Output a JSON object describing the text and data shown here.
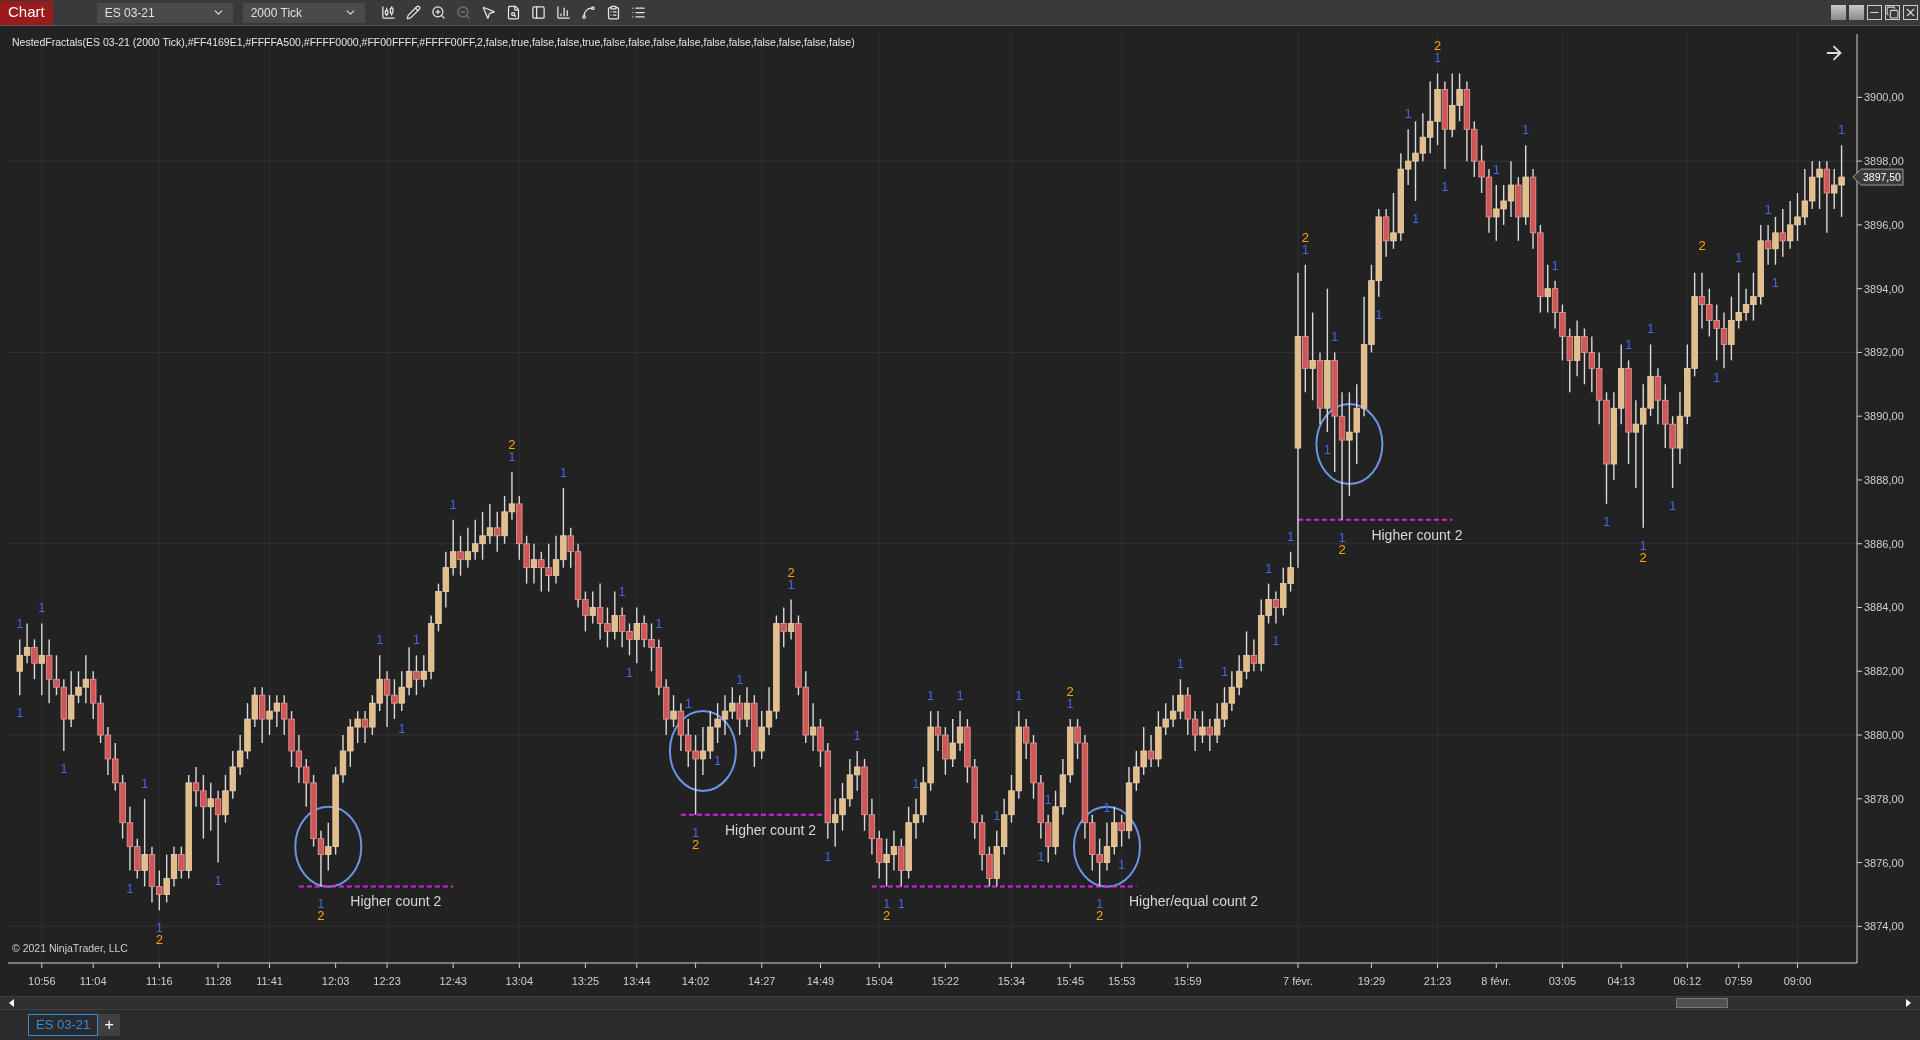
{
  "toolbar": {
    "title": "Chart",
    "instrument": "ES 03-21",
    "interval": "2000 Tick"
  },
  "indicator_label": "NestedFractals(ES 03-21 (2000 Tick),#FF4169E1,#FFFFA500,#FFFF0000,#FF00FFFF,#FFFF00FF,2,false,true,false,false,true,false,false,false,false,false,false,false,false,false,false)",
  "chart": {
    "copyright": "© 2021 NinjaTrader, LLC",
    "price_marker": "3897,50",
    "chart_data": {
      "type": "candlestick",
      "grid": true,
      "ylim": [
        3872.85,
        3902.05
      ],
      "categories": [
        null,
        null,
        null,
        "10:56",
        null,
        null,
        null,
        null,
        null,
        null,
        "11:04",
        null,
        null,
        null,
        null,
        null,
        null,
        null,
        null,
        "11:16",
        null,
        null,
        null,
        null,
        null,
        null,
        null,
        "11:28",
        null,
        null,
        null,
        null,
        null,
        null,
        "11:41",
        null,
        null,
        null,
        null,
        null,
        null,
        null,
        null,
        "12:03",
        null,
        null,
        null,
        null,
        null,
        null,
        "12:23",
        null,
        null,
        null,
        null,
        null,
        null,
        null,
        null,
        "12:43",
        null,
        null,
        null,
        null,
        null,
        null,
        null,
        null,
        "13:04",
        null,
        null,
        null,
        null,
        null,
        null,
        null,
        null,
        "13:25",
        null,
        null,
        null,
        null,
        null,
        null,
        "13:44",
        null,
        null,
        null,
        null,
        null,
        null,
        null,
        "14:02",
        null,
        null,
        null,
        null,
        null,
        null,
        null,
        null,
        "14:27",
        null,
        null,
        null,
        null,
        null,
        null,
        null,
        "14:49",
        null,
        null,
        null,
        null,
        null,
        null,
        null,
        "15:04",
        null,
        null,
        null,
        null,
        null,
        null,
        null,
        null,
        "15:22",
        null,
        null,
        null,
        null,
        null,
        null,
        null,
        null,
        "15:34",
        null,
        null,
        null,
        null,
        null,
        null,
        null,
        "15:45",
        null,
        null,
        null,
        null,
        null,
        null,
        "15:53",
        null,
        null,
        null,
        null,
        null,
        null,
        null,
        null,
        "15:59",
        null,
        null,
        null,
        null,
        null,
        null,
        null,
        null,
        null,
        null,
        null,
        null,
        null,
        null,
        "7 févr.",
        null,
        null,
        null,
        null,
        null,
        null,
        null,
        null,
        null,
        "19:29",
        null,
        null,
        null,
        null,
        null,
        null,
        null,
        null,
        "21:23",
        null,
        null,
        null,
        null,
        null,
        null,
        null,
        "8 févr.",
        null,
        null,
        null,
        null,
        null,
        null,
        null,
        null,
        "03:05",
        null,
        null,
        null,
        null,
        null,
        null,
        null,
        "04:13",
        null,
        null,
        null,
        null,
        null,
        null,
        null,
        null,
        "06:12",
        null,
        null,
        null,
        null,
        null,
        null,
        "07:59",
        null,
        null,
        null,
        null,
        null,
        null,
        null,
        "09:00",
        null,
        null,
        null,
        null,
        null,
        null
      ],
      "yticks": [
        {
          "value": 3874,
          "label": "3874,00"
        },
        {
          "value": 3876,
          "label": "3876,00"
        },
        {
          "value": 3878,
          "label": "3878,00"
        },
        {
          "value": 3880,
          "label": "3880,00"
        },
        {
          "value": 3882,
          "label": "3882,00"
        },
        {
          "value": 3884,
          "label": "3884,00"
        },
        {
          "value": 3886,
          "label": "3886,00"
        },
        {
          "value": 3888,
          "label": "3888,00"
        },
        {
          "value": 3890,
          "label": "3890,00"
        },
        {
          "value": 3892,
          "label": "3892,00"
        },
        {
          "value": 3894,
          "label": "3894,00"
        },
        {
          "value": 3896,
          "label": "3896,00"
        },
        {
          "value": 3898,
          "label": "3898,00"
        },
        {
          "value": 3900,
          "label": "3900,00"
        }
      ],
      "ohlc": [
        [
          3882,
          3883,
          3881.25,
          3882.5
        ],
        [
          3882.5,
          3883.5,
          3882.25,
          3882.75
        ],
        [
          3882.75,
          3883,
          3881.75,
          3882.25
        ],
        [
          3882.25,
          3883.5,
          3881.25,
          3882.5
        ],
        [
          3882.5,
          3883,
          3881,
          3881.75
        ],
        [
          3881.75,
          3882.5,
          3881.25,
          3881.5
        ],
        [
          3881.5,
          3881.75,
          3879.5,
          3880.5
        ],
        [
          3880.5,
          3882,
          3880.25,
          3881.25
        ],
        [
          3881.25,
          3882,
          3881,
          3881.5
        ],
        [
          3881.5,
          3882.5,
          3881,
          3881.75
        ],
        [
          3881.75,
          3882,
          3880.5,
          3881
        ],
        [
          3881,
          3881.25,
          3879.75,
          3880
        ],
        [
          3880,
          3880.25,
          3878.75,
          3879.25
        ],
        [
          3879.25,
          3879.75,
          3878.25,
          3878.5
        ],
        [
          3878.5,
          3878.75,
          3876.75,
          3877.25
        ],
        [
          3877.25,
          3877.75,
          3875.75,
          3876.5
        ],
        [
          3876.5,
          3876.75,
          3875.5,
          3875.75
        ],
        [
          3875.75,
          3878,
          3875.25,
          3876.25
        ],
        [
          3876.25,
          3876.5,
          3874.75,
          3875.25
        ],
        [
          3875.25,
          3875.75,
          3874.5,
          3875
        ],
        [
          3875,
          3876.25,
          3874.75,
          3875.5
        ],
        [
          3875.5,
          3876.5,
          3875.25,
          3876.25
        ],
        [
          3876.25,
          3876.5,
          3875.5,
          3875.75
        ],
        [
          3875.75,
          3878.75,
          3875.5,
          3878.5
        ],
        [
          3878.5,
          3879,
          3877.75,
          3878.25
        ],
        [
          3878.25,
          3878.75,
          3876.75,
          3877.75
        ],
        [
          3877.75,
          3878.5,
          3877,
          3878
        ],
        [
          3878,
          3878.25,
          3876,
          3877.5
        ],
        [
          3877.5,
          3878.75,
          3877.25,
          3878.25
        ],
        [
          3878.25,
          3879.5,
          3878,
          3879
        ],
        [
          3879,
          3880,
          3878.75,
          3879.5
        ],
        [
          3879.5,
          3881,
          3879.25,
          3880.5
        ],
        [
          3880.5,
          3881.5,
          3880.25,
          3881.25
        ],
        [
          3881.25,
          3881.5,
          3879.75,
          3880.5
        ],
        [
          3880.5,
          3881.25,
          3880,
          3880.75
        ],
        [
          3880.75,
          3881.25,
          3880.25,
          3881
        ],
        [
          3881,
          3881.25,
          3880,
          3880.5
        ],
        [
          3880.5,
          3880.75,
          3879,
          3879.5
        ],
        [
          3879.5,
          3880,
          3878.5,
          3879
        ],
        [
          3879,
          3879.25,
          3877.75,
          3878.5
        ],
        [
          3878.5,
          3878.75,
          3876.5,
          3876.75
        ],
        [
          3876.75,
          3877,
          3875.25,
          3876.25
        ],
        [
          3876.25,
          3877.25,
          3875.75,
          3876.5
        ],
        [
          3876.5,
          3879,
          3876.25,
          3878.75
        ],
        [
          3878.75,
          3880,
          3878.5,
          3879.5
        ],
        [
          3879.5,
          3880.5,
          3879,
          3880.25
        ],
        [
          3880.25,
          3880.75,
          3879.75,
          3880.5
        ],
        [
          3880.5,
          3880.75,
          3879.75,
          3880.25
        ],
        [
          3880.25,
          3881.25,
          3880,
          3881
        ],
        [
          3881,
          3882.5,
          3880.75,
          3881.75
        ],
        [
          3881.75,
          3882,
          3880.25,
          3881.25
        ],
        [
          3881.25,
          3881.75,
          3880.5,
          3881
        ],
        [
          3881,
          3882,
          3880.75,
          3881.5
        ],
        [
          3881.5,
          3882.75,
          3881.25,
          3882
        ],
        [
          3882,
          3882.5,
          3881.25,
          3881.75
        ],
        [
          3881.75,
          3882.5,
          3881.5,
          3882
        ],
        [
          3882,
          3883.75,
          3881.75,
          3883.5
        ],
        [
          3883.5,
          3884.75,
          3883.25,
          3884.5
        ],
        [
          3884.5,
          3885.75,
          3884,
          3885.25
        ],
        [
          3885.25,
          3886.75,
          3885,
          3885.75
        ],
        [
          3885.75,
          3886.25,
          3885,
          3885.5
        ],
        [
          3885.5,
          3886.5,
          3885.25,
          3885.75
        ],
        [
          3885.75,
          3886.75,
          3885.5,
          3886
        ],
        [
          3886,
          3887,
          3885.5,
          3886.25
        ],
        [
          3886.25,
          3887.25,
          3886,
          3886.5
        ],
        [
          3886.5,
          3887,
          3885.75,
          3886.25
        ],
        [
          3886.25,
          3887.5,
          3886,
          3887
        ],
        [
          3887,
          3888.25,
          3886.75,
          3887.25
        ],
        [
          3887.25,
          3887.5,
          3885.5,
          3886
        ],
        [
          3886,
          3886.25,
          3884.75,
          3885.25
        ],
        [
          3885.25,
          3886,
          3884.75,
          3885.5
        ],
        [
          3885.5,
          3885.75,
          3884.5,
          3885.25
        ],
        [
          3885.25,
          3886,
          3884.5,
          3885
        ],
        [
          3885,
          3886.25,
          3884.75,
          3885.5
        ],
        [
          3885.5,
          3887.75,
          3885.25,
          3886.25
        ],
        [
          3886.25,
          3886.5,
          3885.25,
          3885.75
        ],
        [
          3885.75,
          3886,
          3884,
          3884.25
        ],
        [
          3884.25,
          3884.5,
          3883.25,
          3883.75
        ],
        [
          3883.75,
          3884.5,
          3883.5,
          3884
        ],
        [
          3884,
          3884.75,
          3883,
          3883.5
        ],
        [
          3883.5,
          3884,
          3882.75,
          3883.25
        ],
        [
          3883.25,
          3884.5,
          3883,
          3883.75
        ],
        [
          3883.75,
          3884,
          3882.75,
          3883.25
        ],
        [
          3883.25,
          3883.5,
          3882.5,
          3883
        ],
        [
          3883,
          3884,
          3882.25,
          3883.5
        ],
        [
          3883.5,
          3883.75,
          3882.75,
          3883
        ],
        [
          3883,
          3883.5,
          3882,
          3882.75
        ],
        [
          3882.75,
          3883,
          3881.25,
          3881.5
        ],
        [
          3881.5,
          3881.75,
          3880,
          3880.5
        ],
        [
          3880.5,
          3881.25,
          3880.25,
          3880.75
        ],
        [
          3880.75,
          3881,
          3879.5,
          3880
        ],
        [
          3880,
          3880.5,
          3879,
          3879.5
        ],
        [
          3879.5,
          3880,
          3877.5,
          3879.25
        ],
        [
          3879.25,
          3880.25,
          3878.75,
          3879.5
        ],
        [
          3879.5,
          3880.75,
          3879.25,
          3880.25
        ],
        [
          3880.25,
          3881,
          3879.75,
          3880.5
        ],
        [
          3880.5,
          3881.25,
          3880,
          3880.75
        ],
        [
          3880.75,
          3881.5,
          3880.5,
          3881
        ],
        [
          3881,
          3881.25,
          3880,
          3880.5
        ],
        [
          3880.5,
          3881.5,
          3880.25,
          3881
        ],
        [
          3881,
          3881.25,
          3879,
          3879.5
        ],
        [
          3879.5,
          3880.75,
          3879.25,
          3880.25
        ],
        [
          3880.25,
          3881.5,
          3880,
          3880.75
        ],
        [
          3880.75,
          3883.75,
          3880.5,
          3883.5
        ],
        [
          3883.5,
          3884,
          3882.75,
          3883.25
        ],
        [
          3883.25,
          3884.25,
          3883,
          3883.5
        ],
        [
          3883.5,
          3883.75,
          3881.25,
          3881.5
        ],
        [
          3881.5,
          3882,
          3879.75,
          3880
        ],
        [
          3880,
          3881,
          3879.5,
          3880.25
        ],
        [
          3880.25,
          3880.5,
          3879,
          3879.5
        ],
        [
          3879.5,
          3879.75,
          3876.75,
          3877.25
        ],
        [
          3877.25,
          3878,
          3876.5,
          3877.5
        ],
        [
          3877.5,
          3878.5,
          3877,
          3878
        ],
        [
          3878,
          3879.25,
          3877.75,
          3878.75
        ],
        [
          3878.75,
          3879.5,
          3878.25,
          3879
        ],
        [
          3879,
          3879.25,
          3877,
          3877.5
        ],
        [
          3877.5,
          3878,
          3876.25,
          3876.75
        ],
        [
          3876.75,
          3877,
          3875.5,
          3876
        ],
        [
          3876,
          3876.75,
          3875.25,
          3876.25
        ],
        [
          3876.25,
          3877,
          3875.75,
          3876.5
        ],
        [
          3876.5,
          3876.75,
          3875.25,
          3875.75
        ],
        [
          3875.75,
          3877.75,
          3875.5,
          3877.25
        ],
        [
          3877.25,
          3878,
          3876.75,
          3877.5
        ],
        [
          3877.5,
          3879,
          3877.25,
          3878.5
        ],
        [
          3878.5,
          3880.75,
          3878.25,
          3880.25
        ],
        [
          3880.25,
          3880.75,
          3879.5,
          3880
        ],
        [
          3880,
          3880.25,
          3878.75,
          3879.25
        ],
        [
          3879.25,
          3880.5,
          3879,
          3879.75
        ],
        [
          3879.75,
          3880.75,
          3879.5,
          3880.25
        ],
        [
          3880.25,
          3880.5,
          3878.5,
          3879
        ],
        [
          3879,
          3879.25,
          3876.75,
          3877.25
        ],
        [
          3877.25,
          3877.5,
          3875.75,
          3876.25
        ],
        [
          3876.25,
          3876.5,
          3875.25,
          3875.5
        ],
        [
          3875.5,
          3877,
          3875.25,
          3876.5
        ],
        [
          3876.5,
          3878,
          3876.25,
          3877.5
        ],
        [
          3877.5,
          3878.75,
          3877.25,
          3878.25
        ],
        [
          3878.25,
          3880.75,
          3878,
          3880.25
        ],
        [
          3880.25,
          3880.5,
          3879.25,
          3879.75
        ],
        [
          3879.75,
          3880,
          3878,
          3878.5
        ],
        [
          3878.5,
          3878.75,
          3876.75,
          3877.25
        ],
        [
          3877.25,
          3877.5,
          3876,
          3876.5
        ],
        [
          3876.5,
          3878.25,
          3876.25,
          3877.75
        ],
        [
          3877.75,
          3879.25,
          3877.5,
          3878.75
        ],
        [
          3878.75,
          3880.5,
          3878.5,
          3880.25
        ],
        [
          3880.25,
          3880.5,
          3879.25,
          3879.75
        ],
        [
          3879.75,
          3880,
          3876.75,
          3877.25
        ],
        [
          3877.25,
          3877.5,
          3875.75,
          3876.25
        ],
        [
          3876.25,
          3876.75,
          3875.25,
          3876
        ],
        [
          3876,
          3877.25,
          3875.75,
          3876.5
        ],
        [
          3876.5,
          3877.75,
          3876.25,
          3877.25
        ],
        [
          3877.25,
          3877.5,
          3876.5,
          3877
        ],
        [
          3877,
          3879,
          3876.75,
          3878.5
        ],
        [
          3878.5,
          3879.5,
          3878.25,
          3879
        ],
        [
          3879,
          3880.25,
          3878.75,
          3879.5
        ],
        [
          3879.5,
          3880,
          3879,
          3879.25
        ],
        [
          3879.25,
          3880.75,
          3879,
          3880.25
        ],
        [
          3880.25,
          3881,
          3880,
          3880.5
        ],
        [
          3880.5,
          3881.25,
          3880.25,
          3880.75
        ],
        [
          3880.75,
          3881.75,
          3880.5,
          3881.25
        ],
        [
          3881.25,
          3881.5,
          3880,
          3880.5
        ],
        [
          3880.5,
          3880.75,
          3879.5,
          3880
        ],
        [
          3880,
          3880.75,
          3879.75,
          3880.25
        ],
        [
          3880.25,
          3880.5,
          3879.5,
          3880
        ],
        [
          3880,
          3881,
          3879.75,
          3880.5
        ],
        [
          3880.5,
          3881.5,
          3880.25,
          3881
        ],
        [
          3881,
          3882,
          3880.75,
          3881.5
        ],
        [
          3881.5,
          3882.5,
          3881.25,
          3882
        ],
        [
          3882,
          3883.25,
          3881.75,
          3882.5
        ],
        [
          3882.5,
          3883,
          3882,
          3882.25
        ],
        [
          3882.25,
          3884.25,
          3882,
          3883.75
        ],
        [
          3883.75,
          3884.75,
          3883.5,
          3884.25
        ],
        [
          3884.25,
          3884.5,
          3883.5,
          3884
        ],
        [
          3884,
          3885.25,
          3883.75,
          3884.75
        ],
        [
          3884.75,
          3885.75,
          3884.5,
          3885.25
        ],
        [
          3889,
          3894.5,
          3885.25,
          3892.5
        ],
        [
          3892.5,
          3894.75,
          3890.75,
          3891.5
        ],
        [
          3891.5,
          3893.25,
          3890.5,
          3891.75
        ],
        [
          3891.75,
          3892,
          3889.75,
          3890.25
        ],
        [
          3890.25,
          3894,
          3889.5,
          3891.75
        ],
        [
          3891.75,
          3892,
          3888.25,
          3890
        ],
        [
          3890,
          3890.75,
          3886.75,
          3889.25
        ],
        [
          3889.25,
          3890.75,
          3887.5,
          3889.5
        ],
        [
          3889.5,
          3891,
          3888.5,
          3890.25
        ],
        [
          3890.25,
          3893.75,
          3890,
          3892.25
        ],
        [
          3892.25,
          3894.75,
          3892,
          3894.25
        ],
        [
          3894.25,
          3896.5,
          3893.75,
          3896.25
        ],
        [
          3896.25,
          3896.5,
          3895,
          3895.5
        ],
        [
          3895.5,
          3897,
          3895.25,
          3895.75
        ],
        [
          3895.75,
          3898.25,
          3895.5,
          3897.75
        ],
        [
          3897.75,
          3899,
          3897.25,
          3898
        ],
        [
          3898,
          3899.25,
          3896.75,
          3898.25
        ],
        [
          3898.25,
          3899.5,
          3898,
          3898.75
        ],
        [
          3898.75,
          3900.5,
          3898.25,
          3899.25
        ],
        [
          3899.25,
          3900.75,
          3898.5,
          3900.25
        ],
        [
          3900.25,
          3900.5,
          3897.75,
          3899
        ],
        [
          3899,
          3900.75,
          3898.75,
          3899.75
        ],
        [
          3899.75,
          3900.75,
          3899.25,
          3900.25
        ],
        [
          3900.25,
          3900.5,
          3898,
          3899
        ],
        [
          3899,
          3899.25,
          3897.5,
          3898
        ],
        [
          3898,
          3898.5,
          3897,
          3897.5
        ],
        [
          3897.5,
          3897.75,
          3895.75,
          3896.25
        ],
        [
          3896.25,
          3897.25,
          3895.5,
          3896.5
        ],
        [
          3896.5,
          3897.25,
          3896,
          3896.75
        ],
        [
          3896.75,
          3898,
          3896.25,
          3897.25
        ],
        [
          3897.25,
          3897.5,
          3895.5,
          3896.25
        ],
        [
          3896.25,
          3898.5,
          3896,
          3897.5
        ],
        [
          3897.5,
          3897.75,
          3895.25,
          3895.75
        ],
        [
          3895.75,
          3896,
          3893.25,
          3893.75
        ],
        [
          3893.75,
          3894.75,
          3893.25,
          3894
        ],
        [
          3894,
          3894.25,
          3892.75,
          3893.25
        ],
        [
          3893.25,
          3893.5,
          3891.75,
          3892.5
        ],
        [
          3892.5,
          3892.75,
          3890.75,
          3891.75
        ],
        [
          3891.75,
          3893,
          3891.25,
          3892.5
        ],
        [
          3892.5,
          3892.75,
          3891,
          3892
        ],
        [
          3892,
          3892.5,
          3890.75,
          3891.5
        ],
        [
          3891.5,
          3892,
          3889.75,
          3890.5
        ],
        [
          3890.5,
          3890.75,
          3887.25,
          3888.5
        ],
        [
          3888.5,
          3890.75,
          3888,
          3890.25
        ],
        [
          3890.25,
          3892.25,
          3889.75,
          3891.5
        ],
        [
          3891.5,
          3891.75,
          3888.5,
          3889.5
        ],
        [
          3889.5,
          3890.5,
          3887.75,
          3889.75
        ],
        [
          3889.75,
          3891,
          3886.5,
          3890.25
        ],
        [
          3890.25,
          3892.25,
          3890,
          3891.25
        ],
        [
          3891.25,
          3891.5,
          3889.75,
          3890.5
        ],
        [
          3890.5,
          3891,
          3889,
          3889.75
        ],
        [
          3889.75,
          3890,
          3887.75,
          3889
        ],
        [
          3889,
          3890.75,
          3888.5,
          3890
        ],
        [
          3890,
          3892.25,
          3889.75,
          3891.5
        ],
        [
          3891.5,
          3894.5,
          3891.25,
          3893.75
        ],
        [
          3893.75,
          3894.5,
          3892.75,
          3893.5
        ],
        [
          3893.5,
          3894,
          3892.5,
          3893
        ],
        [
          3893,
          3893.5,
          3891.75,
          3892.75
        ],
        [
          3892.75,
          3893.25,
          3891.5,
          3892.25
        ],
        [
          3892.25,
          3893.75,
          3891.75,
          3893
        ],
        [
          3893,
          3894.5,
          3892.75,
          3893.25
        ],
        [
          3893.25,
          3894,
          3893,
          3893.5
        ],
        [
          3893.5,
          3894.5,
          3893,
          3893.75
        ],
        [
          3893.75,
          3896,
          3893.5,
          3895.5
        ],
        [
          3895.5,
          3896,
          3894.75,
          3895.25
        ],
        [
          3895.25,
          3896.25,
          3894.75,
          3895.75
        ],
        [
          3895.75,
          3896.5,
          3895,
          3895.5
        ],
        [
          3895.5,
          3896.75,
          3895.25,
          3896
        ],
        [
          3896,
          3897,
          3895.5,
          3896.25
        ],
        [
          3896.25,
          3897.75,
          3896,
          3896.75
        ],
        [
          3896.75,
          3898,
          3896.5,
          3897.5
        ],
        [
          3897.5,
          3898,
          3896.5,
          3897.75
        ],
        [
          3897.75,
          3898,
          3895.75,
          3897
        ],
        [
          3897,
          3897.75,
          3896.5,
          3897.25
        ],
        [
          3897.25,
          3898.5,
          3896.25,
          3897.5
        ]
      ]
    },
    "fractal_labels": [
      {
        "text": "1",
        "color": "#4169e1"
      },
      {
        "text": "1",
        "color": "#4169e1"
      },
      {
        "text": "1",
        "color": "#4169e1"
      },
      {
        "text": "1",
        "color": "#4169e1"
      },
      {
        "text": "1",
        "color": "#4169e1"
      },
      {
        "text": "1",
        "color": "#4169e1"
      },
      {
        "text": "1",
        "color": "#4169e1"
      },
      {
        "text": "2",
        "color": "#ffa500"
      },
      {
        "text": "1",
        "color": "#4169e1"
      },
      {
        "text": "1",
        "color": "#4169e1"
      },
      {
        "text": "2",
        "color": "#ffa500"
      },
      {
        "text": "1",
        "color": "#4169e1"
      },
      {
        "text": "1",
        "color": "#4169e1"
      },
      {
        "text": "1",
        "color": "#4169e1"
      },
      {
        "text": "1",
        "color": "#4169e1"
      },
      {
        "text": "1",
        "color": "#4169e1"
      },
      {
        "text": "2",
        "color": "#ffa500"
      },
      {
        "text": "1",
        "color": "#4169e1"
      },
      {
        "text": "1",
        "color": "#4169e1"
      },
      {
        "text": "1",
        "color": "#4169e1"
      },
      {
        "text": "1",
        "color": "#4169e1"
      },
      {
        "text": "1",
        "color": "#4169e1"
      },
      {
        "text": "1",
        "color": "#4169e1"
      },
      {
        "text": "2",
        "color": "#ffa500"
      },
      {
        "text": "1",
        "color": "#4169e1"
      },
      {
        "text": "1",
        "color": "#4169e1"
      },
      {
        "text": "1",
        "color": "#4169e1"
      },
      {
        "text": "2",
        "color": "#ffa500"
      },
      {
        "text": "1",
        "color": "#4169e1"
      },
      {
        "text": "1",
        "color": "#4169e1"
      },
      {
        "text": "1",
        "color": "#4169e1"
      },
      {
        "text": "2",
        "color": "#ffa500"
      },
      {
        "text": "1",
        "color": "#4169e1"
      },
      {
        "text": "1",
        "color": "#4169e1"
      },
      {
        "text": "1",
        "color": "#4169e1"
      },
      {
        "text": "1",
        "color": "#4169e1"
      },
      {
        "text": "1",
        "color": "#4169e1"
      },
      {
        "text": "1",
        "color": "#4169e1"
      },
      {
        "text": "1",
        "color": "#4169e1"
      },
      {
        "text": "1",
        "color": "#4169e1"
      },
      {
        "text": "1",
        "color": "#4169e1"
      },
      {
        "text": "2",
        "color": "#ffa500"
      },
      {
        "text": "1",
        "color": "#4169e1"
      },
      {
        "text": "2",
        "color": "#ffa500"
      },
      {
        "text": "1",
        "color": "#4169e1"
      },
      {
        "text": "1",
        "color": "#4169e1"
      },
      {
        "text": "1",
        "color": "#4169e1"
      },
      {
        "text": "1",
        "color": "#4169e1"
      },
      {
        "text": "1",
        "color": "#4169e1"
      },
      {
        "text": "1",
        "color": "#4169e1"
      },
      {
        "text": "1",
        "color": "#4169e1"
      },
      {
        "text": "1",
        "color": "#4169e1"
      },
      {
        "text": "2",
        "color": "#ffa500"
      },
      {
        "text": "1",
        "color": "#4169e1"
      },
      {
        "text": "1",
        "color": "#4169e1"
      },
      {
        "text": "1",
        "color": "#4169e1"
      },
      {
        "text": "2",
        "color": "#ffa500"
      },
      {
        "text": "1",
        "color": "#4169e1"
      },
      {
        "text": "1",
        "color": "#4169e1"
      },
      {
        "text": "1",
        "color": "#4169e1"
      },
      {
        "text": "1",
        "color": "#4169e1"
      },
      {
        "text": "2",
        "color": "#ffa500"
      },
      {
        "text": "1",
        "color": "#4169e1"
      },
      {
        "text": "1",
        "color": "#4169e1"
      },
      {
        "text": "1",
        "color": "#4169e1"
      },
      {
        "text": "1",
        "color": "#4169e1"
      },
      {
        "text": "1",
        "color": "#4169e1"
      },
      {
        "text": "1",
        "color": "#4169e1"
      },
      {
        "text": "1",
        "color": "#4169e1"
      },
      {
        "text": "2",
        "color": "#ffa500"
      },
      {
        "text": "1",
        "color": "#4169e1"
      },
      {
        "text": "1",
        "color": "#4169e1"
      },
      {
        "text": "2",
        "color": "#ffa500"
      },
      {
        "text": "1",
        "color": "#4169e1"
      },
      {
        "text": "1",
        "color": "#4169e1"
      },
      {
        "text": "1",
        "color": "#4169e1"
      },
      {
        "text": "1",
        "color": "#4169e1"
      },
      {
        "text": "1",
        "color": "#4169e1"
      }
    ],
    "notes": [
      {
        "text": "Higher count 2"
      },
      {
        "text": "Higher count 2"
      },
      {
        "text": "Higher/equal count 2"
      },
      {
        "text": "Higher count 2"
      }
    ]
  },
  "tabs": [
    {
      "label": "ES 03-21",
      "selected": true
    }
  ],
  "add_tab": "+"
}
